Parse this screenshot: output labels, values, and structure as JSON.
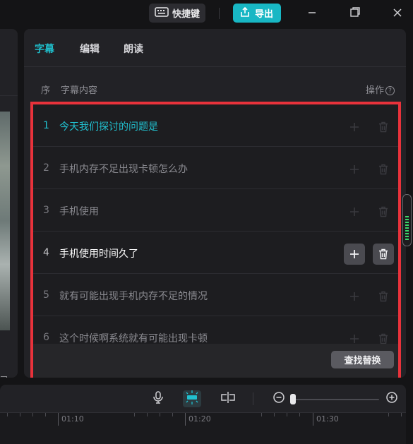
{
  "topbar": {
    "shortcut_label": "快捷键",
    "export_label": "导出",
    "accent": "#18b7c4"
  },
  "panel": {
    "tabs": [
      {
        "label": "字幕",
        "active": true
      },
      {
        "label": "编辑",
        "active": false
      },
      {
        "label": "朗读",
        "active": false
      }
    ],
    "columns": {
      "index": "序",
      "content": "字幕内容",
      "actions": "操作"
    },
    "rows": [
      {
        "index": "1",
        "text": "今天我们探讨的问题是",
        "state": "current"
      },
      {
        "index": "2",
        "text": "手机内存不足出现卡顿怎么办",
        "state": "normal"
      },
      {
        "index": "3",
        "text": "手机使用",
        "state": "normal"
      },
      {
        "index": "4",
        "text": "手机使用时间久了",
        "state": "hover"
      },
      {
        "index": "5",
        "text": "就有可能出现手机内存不足的情况",
        "state": "normal"
      },
      {
        "index": "6",
        "text": "这个时候啊系统就有可能出现卡顿",
        "state": "normal"
      }
    ],
    "find_replace_label": "查找替换",
    "highlight_color": "#e8323b"
  },
  "timeline": {
    "labels": [
      "01:10",
      "01:20",
      "01:30"
    ]
  }
}
